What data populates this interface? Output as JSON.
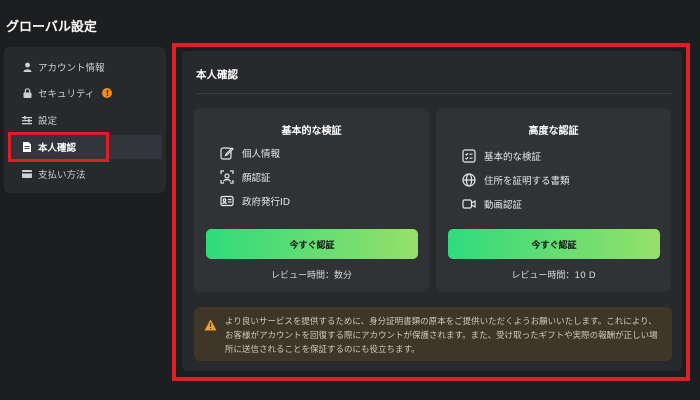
{
  "header": {
    "title": "グローバル設定"
  },
  "sidebar": {
    "items": [
      {
        "label": "アカウント情報",
        "icon": "user-icon"
      },
      {
        "label": "セキュリティ",
        "icon": "lock-icon",
        "badge": "!"
      },
      {
        "label": "設定",
        "icon": "settings-sliders-icon"
      },
      {
        "label": "本人確認",
        "icon": "document-icon",
        "active": true
      },
      {
        "label": "支払い方法",
        "icon": "card-icon"
      }
    ]
  },
  "main": {
    "section_title": "本人確認",
    "cards": [
      {
        "title": "基本的な検証",
        "features": [
          {
            "label": "個人情報",
            "icon": "edit-icon"
          },
          {
            "label": "顔認証",
            "icon": "face-scan-icon"
          },
          {
            "label": "政府発行ID",
            "icon": "id-card-icon"
          }
        ],
        "button": "今すぐ認証",
        "review": "レビュー時間：数分"
      },
      {
        "title": "高度な認証",
        "features": [
          {
            "label": "基本的な検証",
            "icon": "checklist-icon"
          },
          {
            "label": "住所を証明する書類",
            "icon": "globe-icon"
          },
          {
            "label": "動画認証",
            "icon": "video-icon"
          }
        ],
        "button": "今すぐ認証",
        "review": "レビュー時間：10 D"
      }
    ],
    "notice": "より良いサービスを提供するために、身分証明書類の原本をご提供いただくようお願いいたします。これにより、お客様がアカウントを回復する際にアカウントが保護されます。また、受け取ったギフトや実際の報酬が正しい場所に送信されることを保証するのにも役立ちます。"
  },
  "colors": {
    "background": "#1c1d1f",
    "panel": "#27292c",
    "card": "#303336",
    "accent_start": "#2fdb7c",
    "accent_end": "#96e06a",
    "highlight": "#e11d2a",
    "warning": "#f08c1a"
  }
}
